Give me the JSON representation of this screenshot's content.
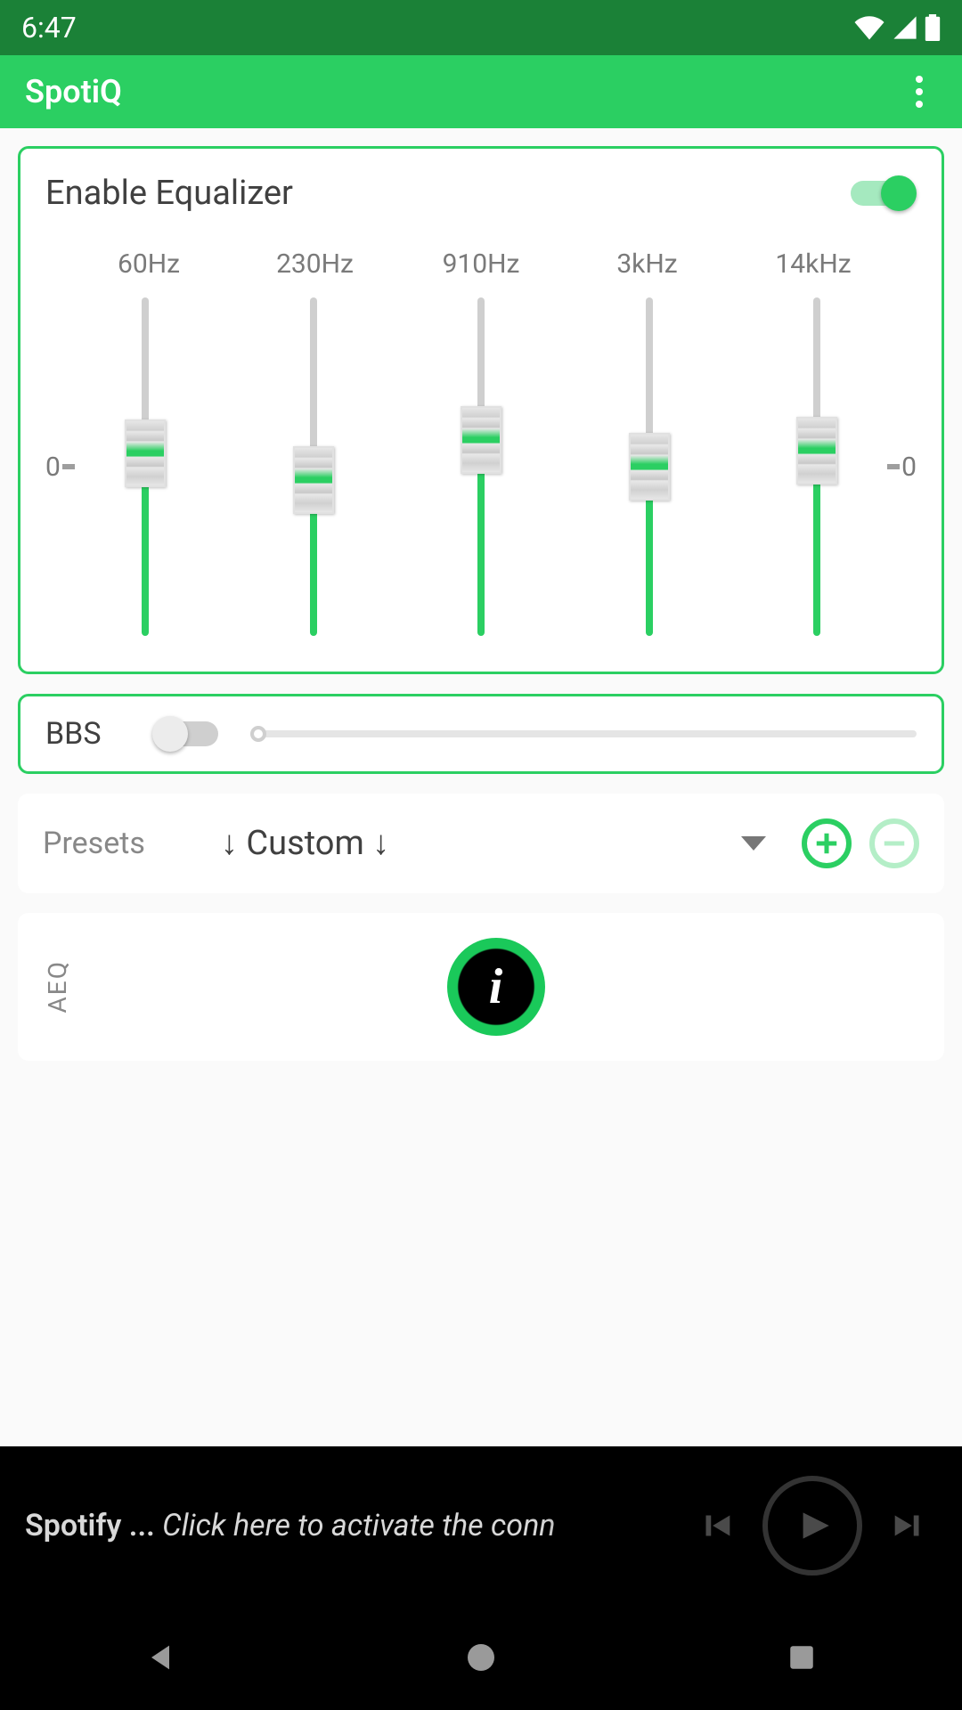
{
  "status": {
    "time": "6:47"
  },
  "app": {
    "title": "SpotiQ"
  },
  "equalizer": {
    "enable_label": "Enable Equalizer",
    "enabled": true,
    "zero_left": "0",
    "zero_right": "0",
    "bands": [
      {
        "label": "60Hz",
        "value": 55
      },
      {
        "label": "230Hz",
        "value": 45
      },
      {
        "label": "910Hz",
        "value": 60
      },
      {
        "label": "3kHz",
        "value": 50
      },
      {
        "label": "14kHz",
        "value": 56
      }
    ]
  },
  "bbs": {
    "label": "BBS",
    "enabled": false,
    "value": 0
  },
  "presets": {
    "label": "Presets",
    "selected": "↓ Custom ↓"
  },
  "aeq": {
    "label": "AEQ"
  },
  "player": {
    "text_prefix": "Spotify ...",
    "text_rest": " Click here to activate the conn"
  }
}
